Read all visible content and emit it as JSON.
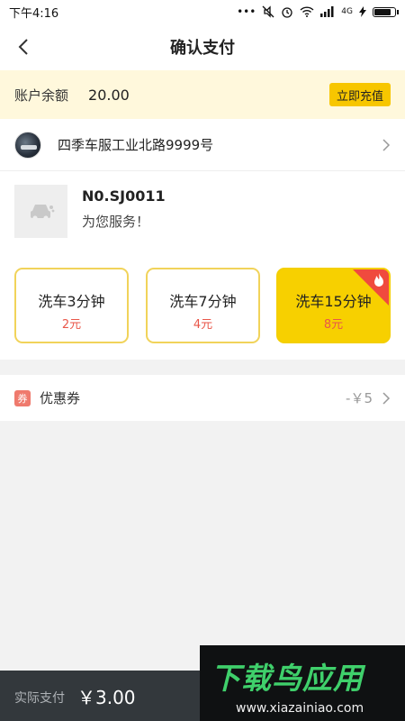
{
  "status_bar": {
    "time": "下午4:16",
    "network": "4G"
  },
  "header": {
    "title": "确认支付"
  },
  "balance": {
    "label": "账户余额",
    "value": "20.00",
    "recharge_label": "立即充值"
  },
  "store": {
    "name": "四季车服工业北路9999号"
  },
  "machine": {
    "number": "N0.SJ0011",
    "message": "为您服务！"
  },
  "options": [
    {
      "name": "洗车3分钟",
      "price": "2元",
      "selected": false
    },
    {
      "name": "洗车7分钟",
      "price": "4元",
      "selected": false
    },
    {
      "name": "洗车15分钟",
      "price": "8元",
      "selected": true,
      "hot": true
    }
  ],
  "coupon": {
    "badge": "券",
    "label": "优惠券",
    "value": "-￥5"
  },
  "footer": {
    "pay_label": "实际支付",
    "pay_amount": "￥3.00"
  },
  "watermark": {
    "title": "下载鸟应用",
    "url": "www.xiazainiao.com"
  },
  "colors": {
    "accent": "#f7d000",
    "price_red": "#e9574a",
    "footer_bg": "#33383c"
  }
}
